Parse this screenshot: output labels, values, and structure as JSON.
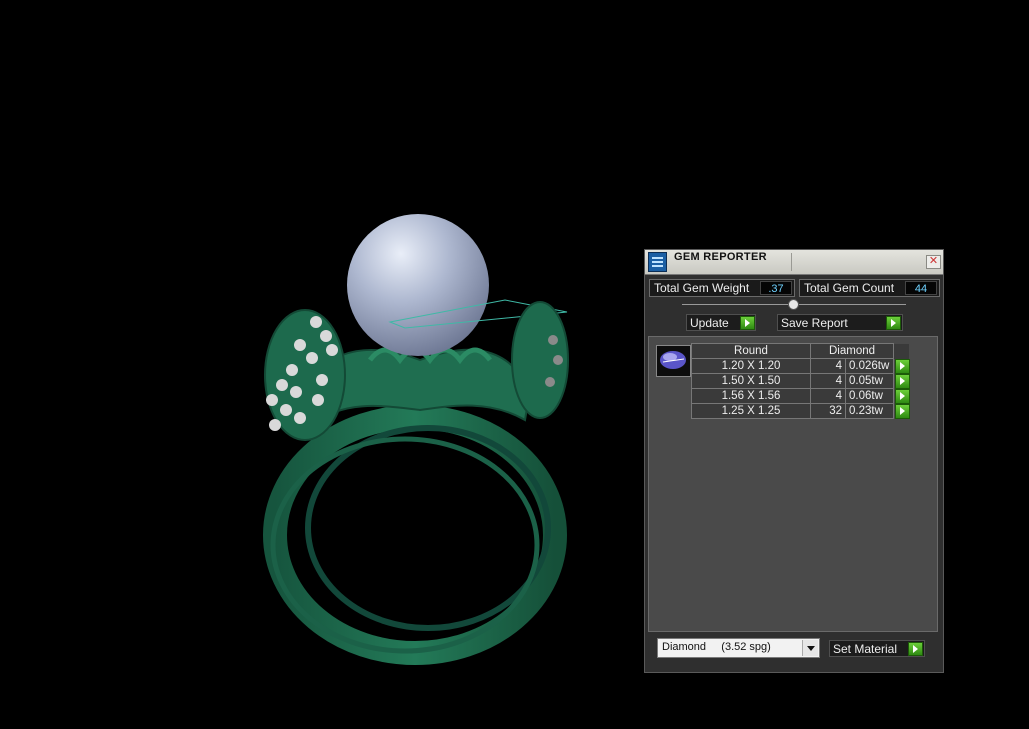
{
  "window": {
    "title": "GEM REPORTER",
    "close_glyph": "✕"
  },
  "stats": {
    "total_weight_label": "Total Gem Weight",
    "total_weight_value": ".37",
    "total_count_label": "Total Gem Count",
    "total_count_value": "44"
  },
  "actions": {
    "update_label": "Update",
    "save_report_label": "Save Report",
    "set_material_label": "Set Material"
  },
  "table": {
    "header_shape": "Round",
    "header_material": "Diamond",
    "rows": [
      {
        "size": "1.20 X 1.20",
        "count": "4",
        "weight": "0.026tw"
      },
      {
        "size": "1.50 X 1.50",
        "count": "4",
        "weight": "0.05tw"
      },
      {
        "size": "1.56 X 1.56",
        "count": "4",
        "weight": "0.06tw"
      },
      {
        "size": "1.25 X 1.25",
        "count": "32",
        "weight": "0.23tw"
      }
    ]
  },
  "material_select": {
    "value": "Diamond     (3.52 spg)"
  },
  "colors": {
    "metal": "#1e6b4f",
    "pearl": "#b7bfd4",
    "accent_green": "#4fb82a",
    "value_text": "#6fd2ff"
  },
  "icons": [
    "gem-reporter-app-icon",
    "close-icon",
    "play-arrow-icon",
    "gem-thumbnail-icon",
    "dropdown-arrow-icon"
  ]
}
